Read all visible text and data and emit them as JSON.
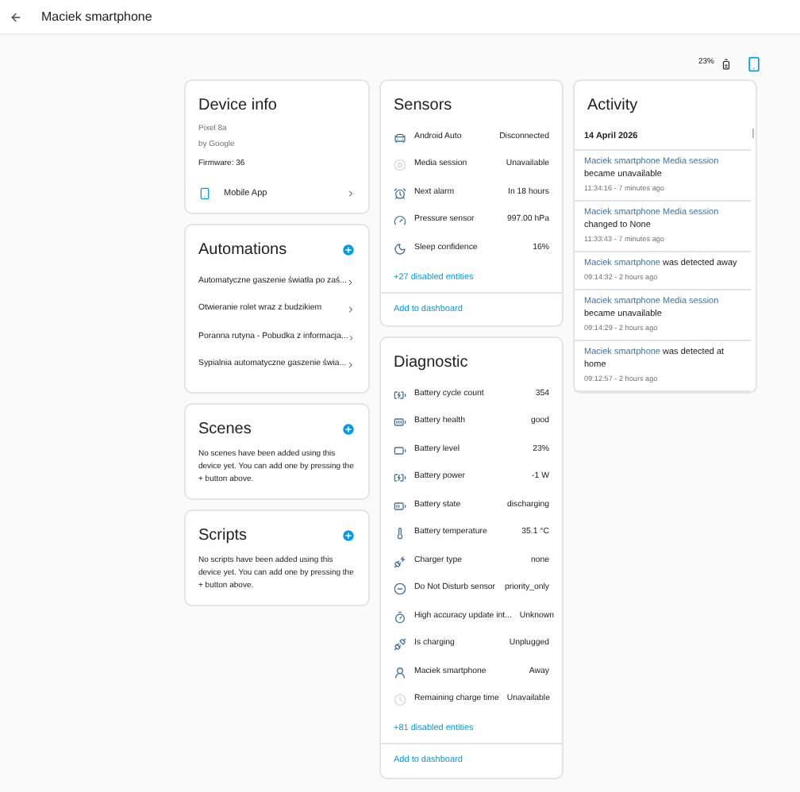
{
  "header": {
    "title": "Maciek smartphone"
  },
  "battery": {
    "reading": "23%"
  },
  "device_info": {
    "title": "Device info",
    "model": "Pixel 8a",
    "manufacturer": "by Google",
    "firmware": "Firmware: 36",
    "integration": "Mobile App"
  },
  "automations": {
    "title": "Automations",
    "items": [
      "Automatyczne gaszenie światła po zaś...",
      "Otwieranie rolet wraz z budzikiem",
      "Poranna rutyna - Pobudka z informacja...",
      "Sypialnia automatyczne gaszenie świa..."
    ]
  },
  "scenes": {
    "title": "Scenes",
    "text": "No scenes have been added using this device yet. You can add one by pressing the + button above."
  },
  "scripts": {
    "title": "Scripts",
    "text": "No scripts have been added using this device yet. You can add one by pressing the + button above."
  },
  "sensors": {
    "title": "Sensors",
    "rows": [
      {
        "name": "Android Auto",
        "value": "Disconnected",
        "disabled": false
      },
      {
        "name": "Media session",
        "value": "Unavailable",
        "disabled": true
      },
      {
        "name": "Next alarm",
        "value": "In 18 hours",
        "disabled": false
      },
      {
        "name": "Pressure sensor",
        "value": "997.00 hPa",
        "disabled": false
      },
      {
        "name": "Sleep confidence",
        "value": "16%",
        "disabled": false
      }
    ],
    "disabled_link": "+27 disabled entities",
    "add": "Add to dashboard"
  },
  "diagnostic": {
    "title": "Diagnostic",
    "rows": [
      {
        "name": "Battery cycle count",
        "value": "354",
        "disabled": false
      },
      {
        "name": "Battery health",
        "value": "good",
        "disabled": false
      },
      {
        "name": "Battery level",
        "value": "23%",
        "disabled": false
      },
      {
        "name": "Battery power",
        "value": "-1 W",
        "disabled": false
      },
      {
        "name": "Battery state",
        "value": "discharging",
        "disabled": false
      },
      {
        "name": "Battery temperature",
        "value": "35.1 °C",
        "disabled": false
      },
      {
        "name": "Charger type",
        "value": "none",
        "disabled": false
      },
      {
        "name": "Do Not Disturb sensor",
        "value": "priority_only",
        "disabled": false
      },
      {
        "name": "High accuracy update int...",
        "value": "Unknown",
        "disabled": false
      },
      {
        "name": "Is charging",
        "value": "Unplugged",
        "disabled": false
      },
      {
        "name": "Maciek smartphone",
        "value": "Away",
        "disabled": false
      },
      {
        "name": "Remaining charge time",
        "value": "Unavailable",
        "disabled": true
      }
    ],
    "disabled_link": "+81 disabled entities",
    "add": "Add to dashboard"
  },
  "activity": {
    "title": "Activity",
    "date": "14 April 2026",
    "entries": [
      {
        "entity": "Maciek smartphone Media session",
        "text": "became unavailable",
        "time": "11:34:16 - 7 minutes ago"
      },
      {
        "entity": "Maciek smartphone Media session",
        "text": "changed to None",
        "time": "11:33:43 - 7 minutes ago"
      },
      {
        "entity": "Maciek smartphone",
        "text": "was detected away",
        "time": "09:14:32 - 2 hours ago"
      },
      {
        "entity": "Maciek smartphone Media session",
        "text": "became unavailable",
        "time": "09:14:29 - 2 hours ago"
      },
      {
        "entity": "Maciek smartphone",
        "text": "was detected at home",
        "time": "09:12:57 - 2 hours ago"
      }
    ]
  }
}
